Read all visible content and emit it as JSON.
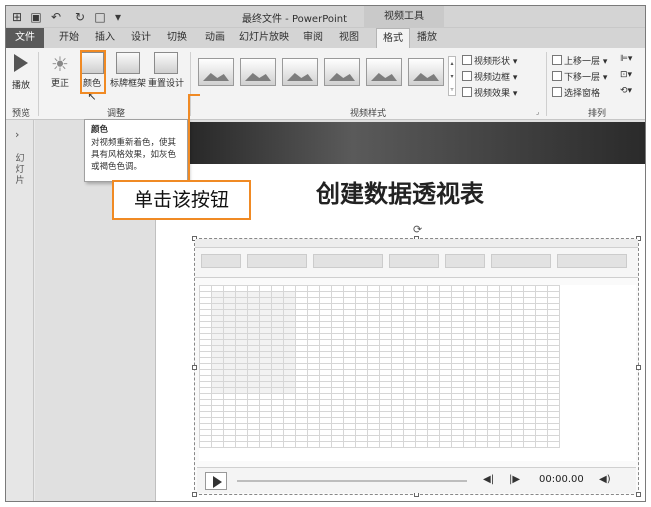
{
  "titlebar": {
    "title": "最终文件 - PowerPoint",
    "context_title": "视频工具"
  },
  "tabs": [
    "文件",
    "开始",
    "插入",
    "设计",
    "切换",
    "动画",
    "幻灯片放映",
    "审阅",
    "视图",
    "格式",
    "播放"
  ],
  "ribbon": {
    "preview": {
      "play": "播放",
      "group": "预览"
    },
    "adjust": {
      "correct": "更正",
      "color": "颜色",
      "poster": "标牌框架",
      "reset": "重置设计",
      "group": "调整"
    },
    "styles": {
      "group": "视频样式"
    },
    "style_cmds": {
      "shape": "视频形状",
      "border": "视频边框",
      "effect": "视频效果"
    },
    "arrange": {
      "up": "上移一层",
      "down": "下移一层",
      "pane": "选择窗格",
      "group": "排列"
    }
  },
  "tooltip": {
    "title": "颜色",
    "body": "对视频重新着色，使其具有风格效果，如灰色或褐色色调。"
  },
  "callout": "单击该按钮",
  "left_panel": {
    "label": "幻灯片"
  },
  "slide": {
    "heading": "创建数据透视表"
  },
  "video": {
    "time": "00:00.00"
  }
}
